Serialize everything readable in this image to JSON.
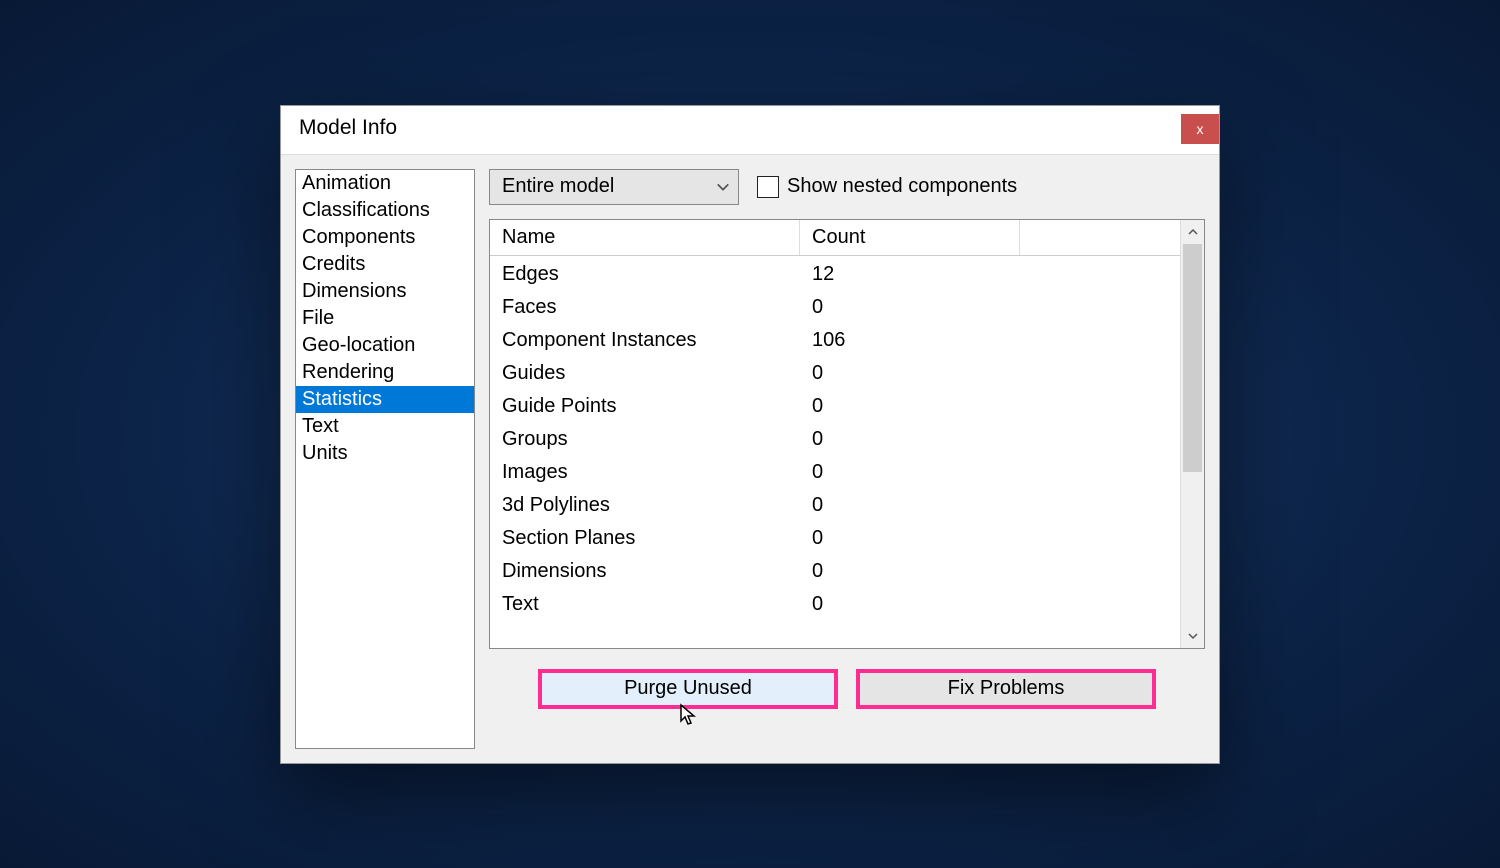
{
  "window": {
    "title": "Model Info",
    "close_label": "x"
  },
  "sidebar": {
    "items": [
      {
        "label": "Animation",
        "selected": false
      },
      {
        "label": "Classifications",
        "selected": false
      },
      {
        "label": "Components",
        "selected": false
      },
      {
        "label": "Credits",
        "selected": false
      },
      {
        "label": "Dimensions",
        "selected": false
      },
      {
        "label": "File",
        "selected": false
      },
      {
        "label": "Geo-location",
        "selected": false
      },
      {
        "label": "Rendering",
        "selected": false
      },
      {
        "label": "Statistics",
        "selected": true
      },
      {
        "label": "Text",
        "selected": false
      },
      {
        "label": "Units",
        "selected": false
      }
    ]
  },
  "controls": {
    "dropdown_value": "Entire model",
    "checkbox_label": "Show nested components",
    "checkbox_checked": false
  },
  "table": {
    "headers": {
      "name": "Name",
      "count": "Count"
    },
    "rows": [
      {
        "name": "Edges",
        "count": "12"
      },
      {
        "name": "Faces",
        "count": "0"
      },
      {
        "name": "Component Instances",
        "count": "106"
      },
      {
        "name": "Guides",
        "count": "0"
      },
      {
        "name": "Guide Points",
        "count": "0"
      },
      {
        "name": "Groups",
        "count": "0"
      },
      {
        "name": "Images",
        "count": "0"
      },
      {
        "name": "3d Polylines",
        "count": "0"
      },
      {
        "name": "Section Planes",
        "count": "0"
      },
      {
        "name": "Dimensions",
        "count": "0"
      },
      {
        "name": "Text",
        "count": "0"
      }
    ]
  },
  "buttons": {
    "purge_label": "Purge Unused",
    "fix_label": "Fix Problems"
  }
}
